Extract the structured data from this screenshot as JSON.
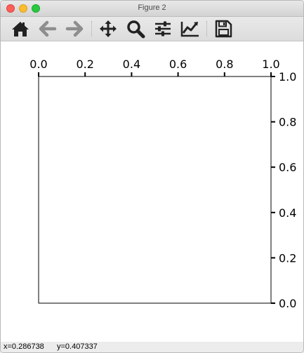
{
  "window": {
    "title": "Figure 2"
  },
  "toolbar": {
    "buttons": [
      {
        "name": "home-icon"
      },
      {
        "name": "back-arrow-icon"
      },
      {
        "name": "forward-arrow-icon"
      },
      {
        "name": "pan-icon"
      },
      {
        "name": "zoom-icon"
      },
      {
        "name": "subplots-config-icon"
      },
      {
        "name": "edit-axis-icon"
      },
      {
        "name": "save-icon"
      }
    ]
  },
  "chart_data": {
    "type": "line",
    "series": [],
    "title": "",
    "xlabel": "",
    "ylabel": "",
    "xlim": [
      0.0,
      1.0
    ],
    "ylim": [
      0.0,
      1.0
    ],
    "x_ticks": [
      "0.0",
      "0.2",
      "0.4",
      "0.6",
      "0.8",
      "1.0"
    ],
    "y_ticks": [
      "0.0",
      "0.2",
      "0.4",
      "0.6",
      "0.8",
      "1.0"
    ],
    "x_axis_position": "top",
    "y_axis_position": "right",
    "grid": false
  },
  "status": {
    "x": "x=0.286738",
    "y": "y=0.407337"
  },
  "colors": {
    "accent_disabled": "#8e8e8e",
    "icon": "#222222"
  }
}
